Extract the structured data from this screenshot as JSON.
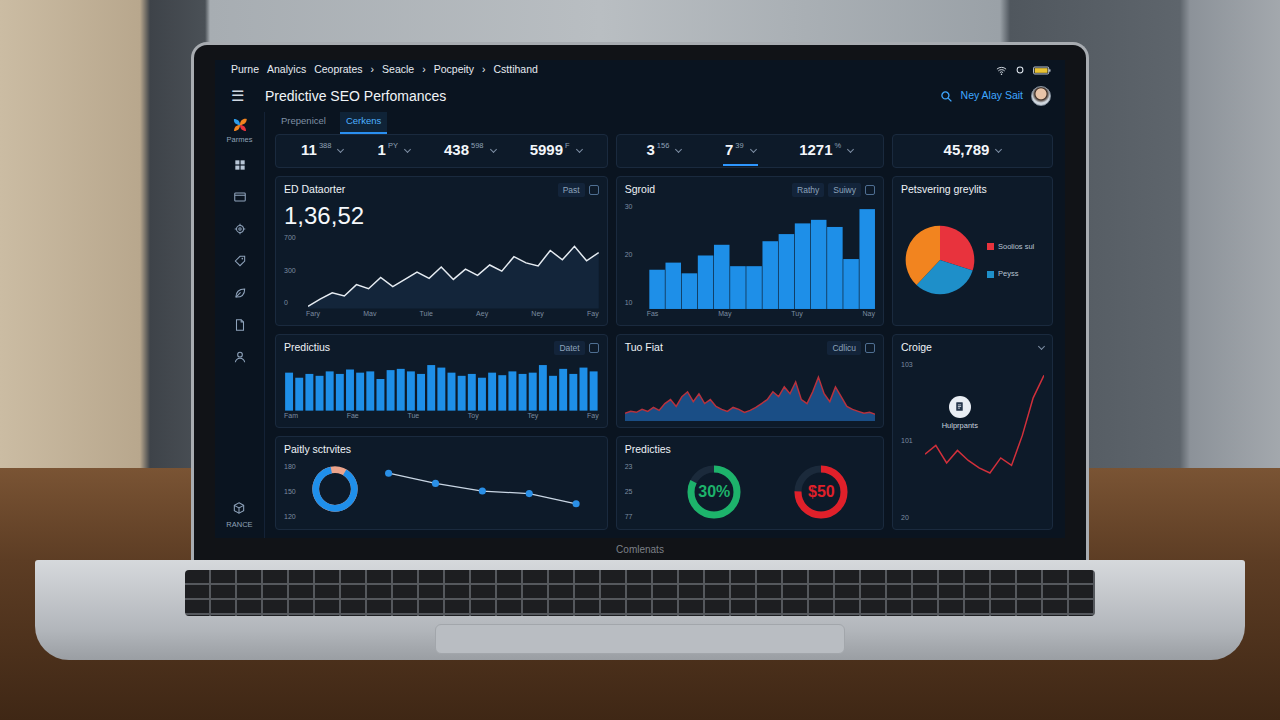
{
  "window": {
    "breadcrumbs": [
      "Purne",
      "Analyics",
      "Ceoprates",
      "›",
      "Seacle",
      "›",
      "Pocpeity",
      "›",
      "Csttihand"
    ]
  },
  "header": {
    "menu": "☰",
    "title": "Predictive SEO Perfomances",
    "user": "Ney Alay Sait"
  },
  "tabs": [
    {
      "label": "Prepenicel",
      "selected": false
    },
    {
      "label": "Cerkens",
      "selected": true
    }
  ],
  "sidebar": {
    "logo_caption": "Parmes",
    "items": [
      {
        "selected": false
      },
      {
        "selected": false
      },
      {
        "selected": false
      },
      {
        "selected": false
      },
      {
        "selected": false
      },
      {
        "selected": false
      },
      {
        "selected": false
      }
    ],
    "footer": "RANCE"
  },
  "kpis": [
    {
      "items": [
        {
          "value": "11",
          "sub": "388",
          "selected": false
        },
        {
          "value": "1",
          "sub": "PY",
          "selected": false
        },
        {
          "value": "438",
          "sub": "598",
          "selected": false
        },
        {
          "value": "5999",
          "sub": "F",
          "selected": false
        }
      ]
    },
    {
      "items": [
        {
          "value": "3",
          "sub": "156",
          "selected": false
        },
        {
          "value": "7",
          "sub": "39",
          "selected": true
        },
        {
          "value": "1271",
          "sub": "%",
          "selected": false
        }
      ]
    },
    {
      "items": [
        {
          "value": "45,789",
          "selected": false
        }
      ]
    }
  ],
  "traffic": {
    "title": "ED Dataorter",
    "buttons": [
      "Past"
    ],
    "total": "1,36,52",
    "y_ticks": [
      "700",
      "300",
      "0"
    ],
    "x_labels": [
      "Fary",
      "Mav",
      "Tuie",
      "Aey",
      "Ney",
      "Fay"
    ],
    "values": [
      20,
      90,
      150,
      120,
      230,
      190,
      300,
      210,
      280,
      350,
      290,
      400,
      280,
      380,
      320,
      420,
      360,
      500,
      440,
      410,
      560,
      470,
      600,
      460,
      540
    ]
  },
  "segments": {
    "title": "Sgroid",
    "buttons": [
      "Rathy",
      "Suiwy"
    ],
    "y_ticks": [
      "30",
      "20",
      "10"
    ],
    "x_labels": [
      "Fas",
      "May",
      "Tuy",
      "Nay"
    ],
    "values": [
      11,
      13,
      10,
      15,
      18,
      12,
      12,
      19,
      21,
      24,
      25,
      23,
      14,
      28
    ]
  },
  "pie": {
    "title": "Petsvering greylits",
    "slices": [
      {
        "label": "Soolios sul",
        "value": 30,
        "color": "#e8333d"
      },
      {
        "label": "Peyss",
        "value": 32,
        "color": "#1e8fc9"
      },
      {
        "value": 38,
        "color": "#f2841f"
      }
    ]
  },
  "predictions": {
    "title": "Predictius",
    "buttons": [
      "Datet"
    ],
    "x_labels": [
      "Fam",
      "Fae",
      "Tue",
      "Toy",
      "Tey",
      "Fay"
    ],
    "values": [
      60,
      52,
      58,
      55,
      62,
      58,
      65,
      60,
      62,
      50,
      64,
      66,
      62,
      58,
      72,
      68,
      60,
      55,
      58,
      52,
      60,
      56,
      62,
      58,
      60,
      72,
      55,
      66,
      58,
      68,
      62
    ]
  },
  "tuo_fiat": {
    "title": "Tuo Fiat",
    "buttons": [
      "Cdlicu"
    ],
    "values": [
      8,
      10,
      9,
      12,
      10,
      14,
      11,
      18,
      22,
      15,
      25,
      30,
      20,
      28,
      18,
      22,
      15,
      12,
      10,
      14,
      12,
      9,
      11,
      14,
      18,
      22,
      30,
      25,
      35,
      28,
      40,
      22,
      18,
      30,
      45,
      28,
      20,
      35,
      25,
      15,
      12,
      10,
      8,
      9,
      7
    ]
  },
  "croige": {
    "title": "Croige",
    "y_ticks": [
      "103",
      "101",
      "20"
    ],
    "marker": "Hulprpants",
    "values": [
      55,
      62,
      48,
      58,
      50,
      44,
      40,
      52,
      46,
      70,
      100,
      118
    ]
  },
  "activities": {
    "title": "Paitly sctrvites",
    "y_ticks": [
      "180",
      "150",
      "120"
    ],
    "level": 0.88,
    "values": [
      90,
      70,
      55,
      50,
      30
    ]
  },
  "forecast": {
    "title": "Predicties",
    "y_ticks": [
      "23",
      "25",
      "77"
    ],
    "gauges": [
      {
        "reading": "30%",
        "level": 0.82,
        "color": "#1db36b"
      },
      {
        "reading": "$50",
        "level": 0.75,
        "color": "#e0202a"
      }
    ]
  },
  "laptop_label": "Comlenats"
}
